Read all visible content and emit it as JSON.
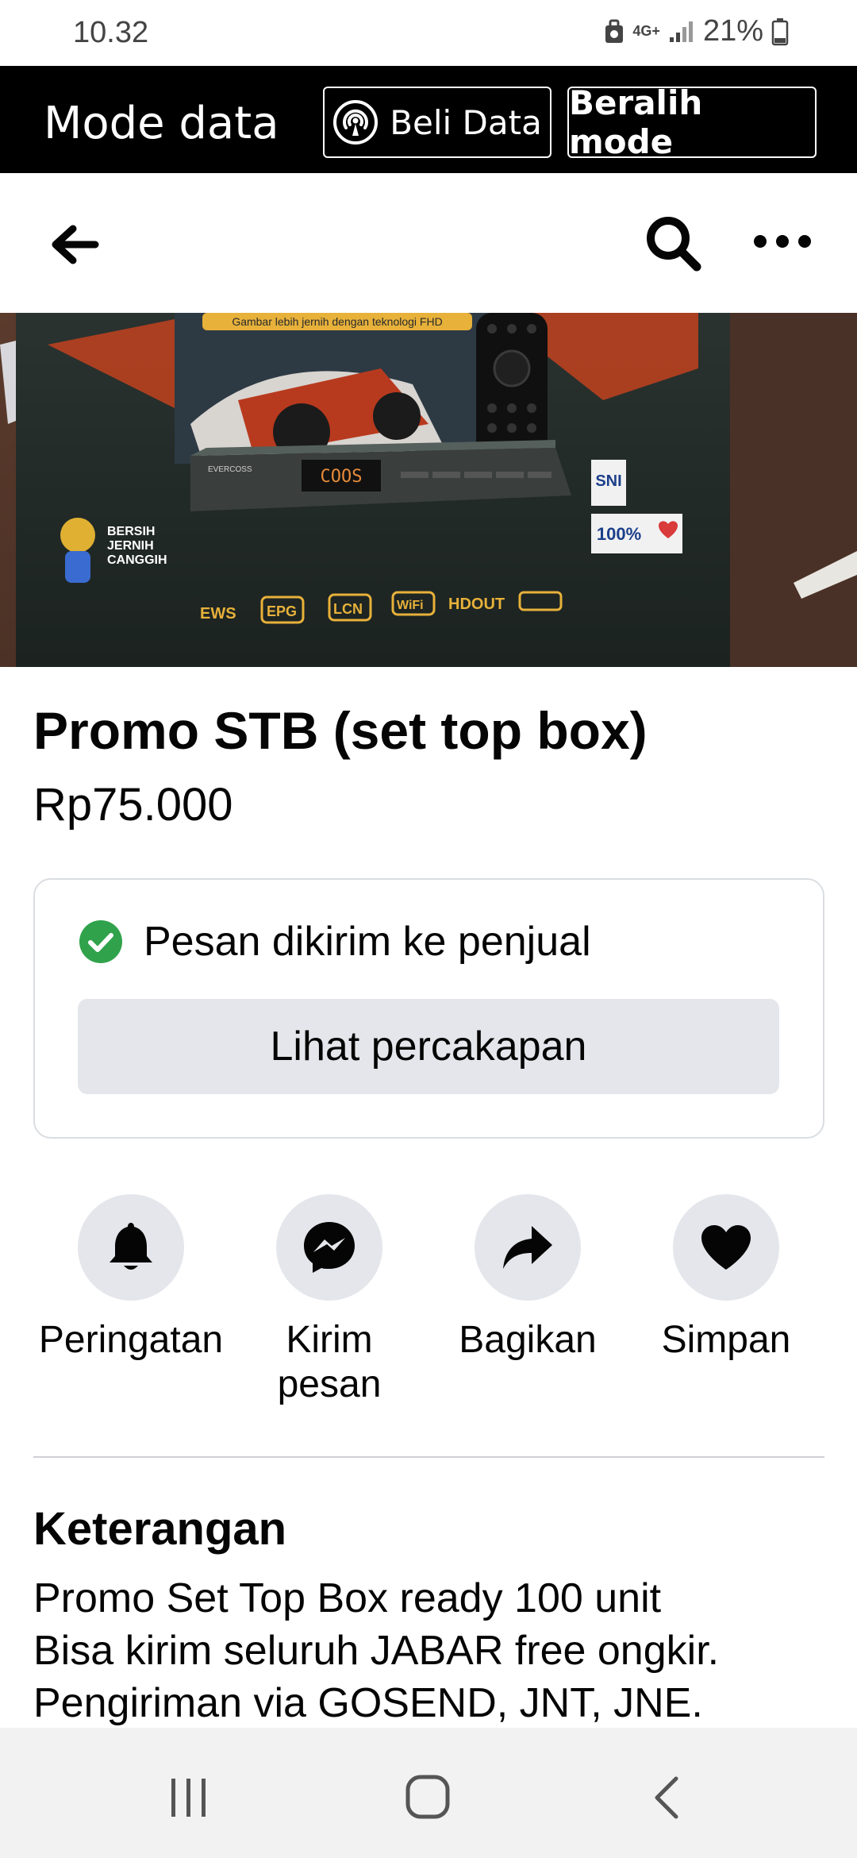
{
  "status_bar": {
    "time": "10.32",
    "network": "4G+",
    "battery": "21%"
  },
  "data_mode_bar": {
    "title": "Mode data",
    "buy_data_label": "Beli Data",
    "switch_mode_label": "Beralih mode"
  },
  "listing": {
    "title": "Promo STB (set top box)",
    "price": "Rp75.000"
  },
  "message": {
    "status": "Pesan dikirim ke penjual",
    "view_label": "Lihat percakapan"
  },
  "actions": [
    {
      "label": "Peringatan",
      "icon": "bell-icon"
    },
    {
      "label": "Kirim pesan",
      "icon": "messenger-icon"
    },
    {
      "label": "Bagikan",
      "icon": "share-icon"
    },
    {
      "label": "Simpan",
      "icon": "heart-icon"
    }
  ],
  "description": {
    "heading": "Keterangan",
    "lines": [
      "Promo Set Top Box ready 100 unit",
      "Bisa kirim seluruh JABAR free ongkir.",
      "Pengiriman via GOSEND, JNT, JNE."
    ]
  },
  "image_print": {
    "tagline": "Gambar lebih jernih dengan teknologi FHD",
    "slogan_1": "BERSIH",
    "slogan_2": "JERNIH",
    "slogan_3": "CANGGIH",
    "brand": "EVERCOSS",
    "display": "COOS",
    "features": [
      "EWS",
      "EPG",
      "LCN",
      "WiFi",
      "HDOUT"
    ],
    "badge": "SNI",
    "badge2": "100%"
  },
  "colors": {
    "accent": "#1877f2",
    "success": "#31a24c",
    "button_gray": "#e4e6eb"
  }
}
